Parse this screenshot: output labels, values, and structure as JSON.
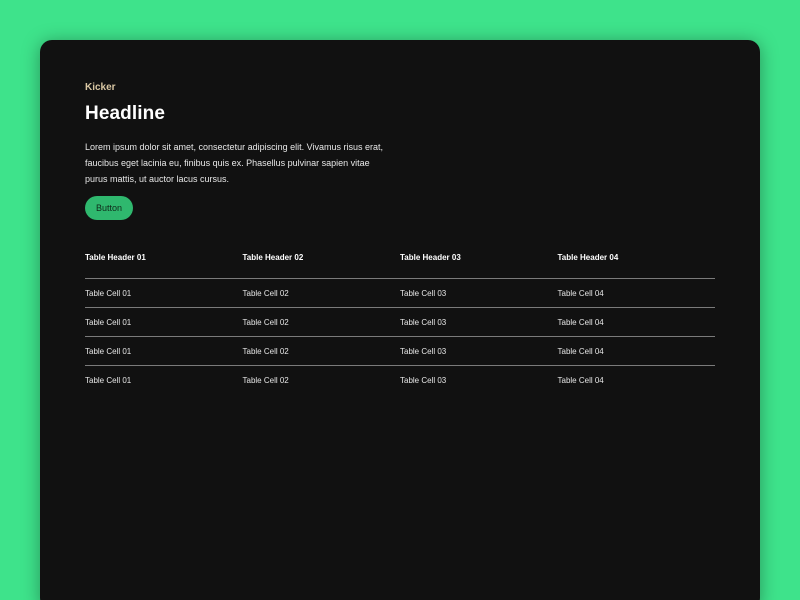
{
  "hero": {
    "kicker": "Kicker",
    "headline": "Headline",
    "body": "Lorem ipsum dolor sit amet, consectetur adipiscing elit. Vivamus risus erat, faucibus eget lacinia eu, finibus quis ex. Phasellus pulvinar sapien vitae purus mattis, ut auctor lacus cursus.",
    "button_label": "Button"
  },
  "colors": {
    "page_background": "#3ee38b",
    "card_background": "#111111",
    "accent": "#2fb86e",
    "kicker": "#d9c7a3"
  },
  "table": {
    "headers": [
      "Table Header 01",
      "Table Header 02",
      "Table Header 03",
      "Table Header 04"
    ],
    "rows": [
      [
        "Table Cell 01",
        "Table Cell 02",
        "Table Cell 03",
        "Table Cell 04"
      ],
      [
        "Table Cell 01",
        "Table Cell 02",
        "Table Cell 03",
        "Table Cell 04"
      ],
      [
        "Table Cell 01",
        "Table Cell 02",
        "Table Cell 03",
        "Table Cell 04"
      ],
      [
        "Table Cell 01",
        "Table Cell 02",
        "Table Cell 03",
        "Table Cell 04"
      ]
    ]
  }
}
